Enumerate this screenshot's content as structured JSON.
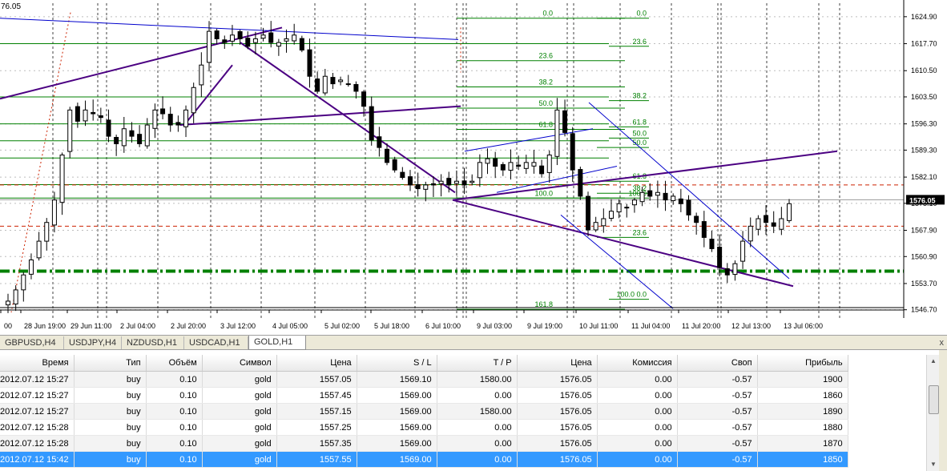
{
  "chart_data": {
    "type": "candlestick",
    "symbol_period": "GOLD,H1",
    "corner_label": "76.05",
    "current_price": "1576.05",
    "price_ticks": [
      "1624.90",
      "1617.70",
      "1610.50",
      "1603.50",
      "1596.30",
      "1589.30",
      "1582.10",
      "1575.10",
      "1567.90",
      "1560.90",
      "1553.70",
      "1546.70"
    ],
    "price_tick_values": [
      1624.9,
      1617.7,
      1610.5,
      1603.5,
      1596.3,
      1589.3,
      1582.1,
      1575.1,
      1567.9,
      1560.9,
      1553.7,
      1546.7
    ],
    "time_ticks": [
      "00",
      "28 Jun 19:00",
      "29 Jun 11:00",
      "2 Jul 04:00",
      "2 Jul 20:00",
      "3 Jul 12:00",
      "4 Jul 05:00",
      "5 Jul 02:00",
      "5 Jul 18:00",
      "6 Jul 10:00",
      "9 Jul 03:00",
      "9 Jul 19:00",
      "10 Jul 11:00",
      "11 Jul 04:00",
      "11 Jul 20:00",
      "12 Jul 13:00",
      "13 Jul 06:00"
    ],
    "ylim": [
      1544.5,
      1628.5
    ],
    "fibo_labels_1": [
      "0.0",
      "23.6",
      "38.2",
      "50.0",
      "61.8",
      "100.0",
      "161.8"
    ],
    "fibo_labels_1_levels": [
      0,
      23.6,
      38.2,
      50.0,
      61.8,
      100.0,
      161.8
    ],
    "fibo_labels_2": [
      "100.0",
      "23.6",
      "38.2",
      "61.8",
      "50.0",
      "0.0"
    ],
    "fibo_labels_3": [
      "61.8",
      "50.0",
      "38.2",
      "23.6",
      "100.0 0.0"
    ],
    "price_path": [
      1549,
      1552,
      1556,
      1560,
      1565,
      1570,
      1576,
      1588,
      1600,
      1597,
      1600,
      1599,
      1598,
      1593,
      1591,
      1595,
      1593,
      1591,
      1596,
      1600,
      1599,
      1596,
      1596,
      1600,
      1606,
      1612,
      1621,
      1619,
      1618,
      1620,
      1619,
      1617,
      1619,
      1620,
      1618,
      1618,
      1619,
      1620,
      1616,
      1609,
      1605,
      1609,
      1607,
      1608,
      1607,
      1605,
      1601,
      1592,
      1590,
      1586,
      1584,
      1582,
      1580,
      1579,
      1580,
      1580,
      1581,
      1580,
      1581,
      1580,
      1581,
      1586,
      1587,
      1585,
      1584,
      1586,
      1585,
      1586,
      1586,
      1583,
      1588,
      1600,
      1594,
      1584,
      1577,
      1568,
      1570,
      1571,
      1573,
      1575,
      1574,
      1576,
      1578,
      1577,
      1578,
      1576,
      1577,
      1575,
      1572,
      1570,
      1566,
      1563,
      1558,
      1556,
      1559,
      1565,
      1569,
      1571,
      1570,
      1569,
      1571,
      1575
    ]
  },
  "tabs": [
    "GBPUSD,H4",
    "USDJPY,H4",
    "NZDUSD,H1",
    "USDCAD,H1",
    "GOLD,H1"
  ],
  "active_tab": 4,
  "tabs_close": "x",
  "table": {
    "columns": [
      "Время",
      "Тип",
      "Объём",
      "Символ",
      "Цена",
      "S / L",
      "T / P",
      "Цена",
      "Комиссия",
      "Своп",
      "Прибыль"
    ],
    "rows": [
      [
        "2012.07.12 15:27",
        "buy",
        "0.10",
        "gold",
        "1557.05",
        "1569.10",
        "1580.00",
        "1576.05",
        "0.00",
        "-0.57",
        "1900"
      ],
      [
        "2012.07.12 15:27",
        "buy",
        "0.10",
        "gold",
        "1557.45",
        "1569.00",
        "0.00",
        "1576.05",
        "0.00",
        "-0.57",
        "1860"
      ],
      [
        "2012.07.12 15:27",
        "buy",
        "0.10",
        "gold",
        "1557.15",
        "1569.00",
        "1580.00",
        "1576.05",
        "0.00",
        "-0.57",
        "1890"
      ],
      [
        "2012.07.12 15:28",
        "buy",
        "0.10",
        "gold",
        "1557.25",
        "1569.00",
        "0.00",
        "1576.05",
        "0.00",
        "-0.57",
        "1880"
      ],
      [
        "2012.07.12 15:28",
        "buy",
        "0.10",
        "gold",
        "1557.35",
        "1569.00",
        "0.00",
        "1576.05",
        "0.00",
        "-0.57",
        "1870"
      ],
      [
        "2012.07.12 15:42",
        "buy",
        "0.10",
        "gold",
        "1557.55",
        "1569.00",
        "0.00",
        "1576.05",
        "0.00",
        "-0.57",
        "1850"
      ]
    ],
    "selected_row": 5
  },
  "colors": {
    "candle": "#000000",
    "fibo": "#008000",
    "trendline": "#4b0082",
    "channel": "#0000cc",
    "price_tag_bg": "#000000",
    "selection": "#3399ff",
    "dashed_green": "#008000",
    "red_dashed": "#cc2200"
  }
}
